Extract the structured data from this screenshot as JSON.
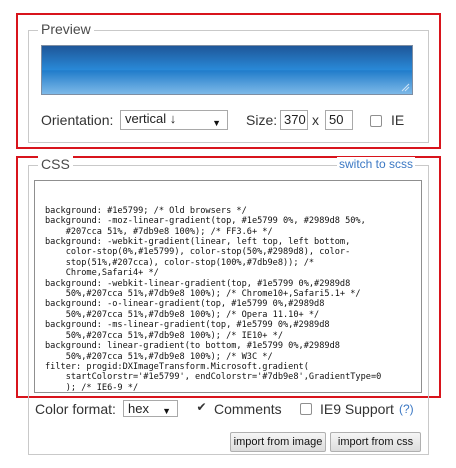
{
  "preview": {
    "legend": "Preview",
    "orientation_label": "Orientation:",
    "orientation_value": "vertical ↓",
    "size_label": "Size:",
    "width": "370",
    "size_separator": "x",
    "height": "50",
    "ie_label": "IE",
    "gradient_colors": [
      "#1e5799",
      "#2989d8",
      "#207cca",
      "#7db9e8"
    ]
  },
  "css": {
    "legend": "CSS",
    "switch_link": "switch to scss",
    "code_lines": [
      "background: #1e5799; /* Old browsers */",
      "background: -moz-linear-gradient(top, #1e5799 0%, #2989d8 50%,",
      "    #207cca 51%, #7db9e8 100%); /* FF3.6+ */",
      "background: -webkit-gradient(linear, left top, left bottom,",
      "    color-stop(0%,#1e5799), color-stop(50%,#2989d8), color-",
      "    stop(51%,#207cca), color-stop(100%,#7db9e8)); /*",
      "    Chrome,Safari4+ */",
      "background: -webkit-linear-gradient(top, #1e5799 0%,#2989d8",
      "    50%,#207cca 51%,#7db9e8 100%); /* Chrome10+,Safari5.1+ */",
      "background: -o-linear-gradient(top, #1e5799 0%,#2989d8",
      "    50%,#207cca 51%,#7db9e8 100%); /* Opera 11.10+ */",
      "background: -ms-linear-gradient(top, #1e5799 0%,#2989d8",
      "    50%,#207cca 51%,#7db9e8 100%); /* IE10+ */",
      "background: linear-gradient(to bottom, #1e5799 0%,#2989d8",
      "    50%,#207cca 51%,#7db9e8 100%); /* W3C */",
      "filter: progid:DXImageTransform.Microsoft.gradient(",
      "    startColorstr='#1e5799', endColorstr='#7db9e8',GradientType=0",
      "    ); /* IE6-9 */"
    ],
    "color_format_label": "Color format:",
    "color_format_value": "hex",
    "comments_label": "Comments",
    "comments_checked": true,
    "ie9_label": "IE9 Support",
    "ie9_help": "(?)",
    "import_image_button": "import from image",
    "import_css_button": "import from css"
  },
  "colors": {
    "highlight": "#d8141c",
    "link": "#3b78c4"
  }
}
